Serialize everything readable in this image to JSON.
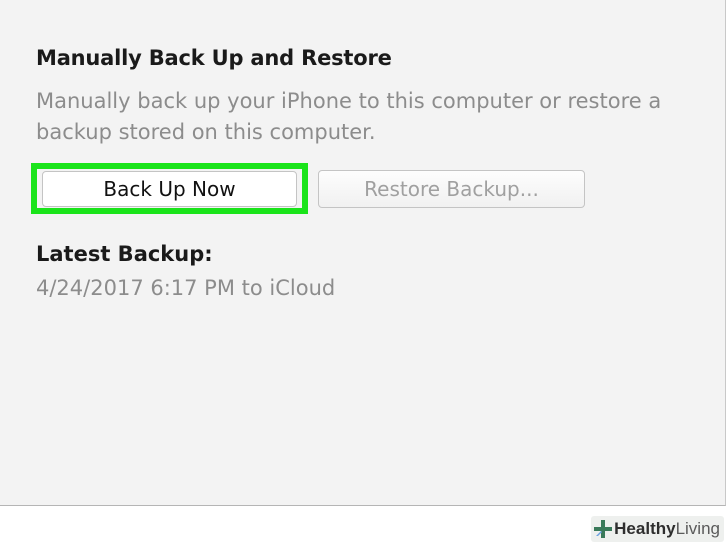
{
  "backup_section": {
    "title": "Manually Back Up and Restore",
    "description": "Manually back up your iPhone to this computer or restore a backup stored on this computer.",
    "back_up_now_label": "Back Up Now",
    "restore_backup_label": "Restore Backup..."
  },
  "latest_backup": {
    "label": "Latest Backup:",
    "value": "4/24/2017 6:17 PM to iCloud"
  },
  "watermark": {
    "strong": "Healthy",
    "light": "Living",
    "icon": "plus-cross-icon"
  },
  "colors": {
    "panel_background": "#f3f3f3",
    "highlight": "#1ae41a",
    "secondary_text": "#8c8c8c",
    "disabled_text": "#a0a0a0"
  }
}
